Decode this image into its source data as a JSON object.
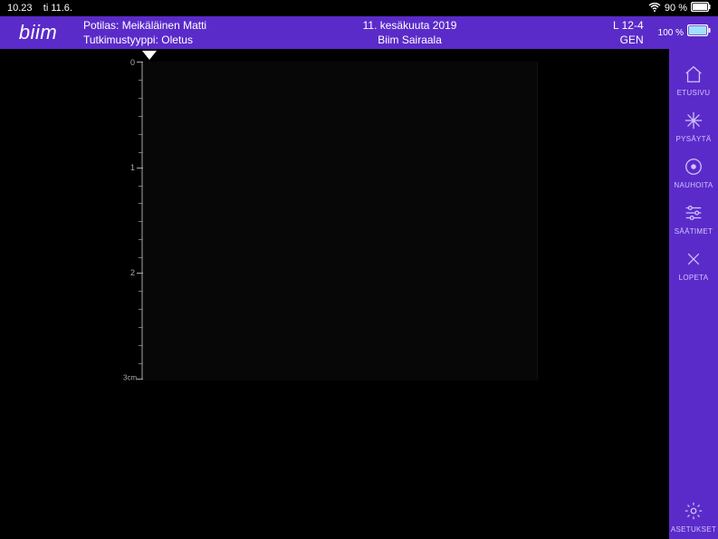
{
  "status": {
    "time": "10.23",
    "date": "ti 11.6.",
    "battery": "90 %"
  },
  "header": {
    "logo": "biim",
    "patient_label": "Potilas:",
    "patient_name": "Meikäläinen Matti",
    "exam_type_label": "Tutkimustyyppi:",
    "exam_type": "Oletus",
    "date_line": "11. kesäkuuta 2019",
    "site_line": "Biim Sairaala",
    "probe": "L 12-4",
    "mode": "GEN",
    "probe_battery": "100 %"
  },
  "ruler": {
    "t0": "0",
    "t1": "1",
    "t2": "2",
    "t3": "3cm"
  },
  "sidebar": {
    "home": "ETUSIVU",
    "pause": "PYSÄYTÄ",
    "record": "NAUHOITA",
    "controls": "SÄÄTIMET",
    "stop": "LOPETA",
    "settings": "ASETUKSET"
  }
}
